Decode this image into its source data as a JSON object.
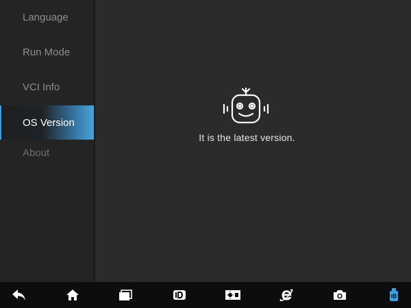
{
  "sidebar": {
    "items": [
      {
        "label": "Language"
      },
      {
        "label": "Run Mode"
      },
      {
        "label": "VCI Info"
      },
      {
        "label": "OS Version",
        "active": true
      },
      {
        "label": "About"
      }
    ]
  },
  "main": {
    "status_icon": "robot-icon",
    "status_text": "It is the latest version."
  },
  "bottombar": {
    "icons": [
      "back-icon",
      "home-icon",
      "recent-apps-icon",
      "diagnostic-app-icon",
      "brightness-icon",
      "browser-icon",
      "camera-icon",
      "vci-connection-icon"
    ]
  },
  "colors": {
    "accent": "#4aa5dc",
    "vci_icon": "#3aa0e8",
    "sidebar_bg": "#242424",
    "main_bg": "#2b2b2b",
    "bottombar_bg": "#0d0d0d"
  }
}
